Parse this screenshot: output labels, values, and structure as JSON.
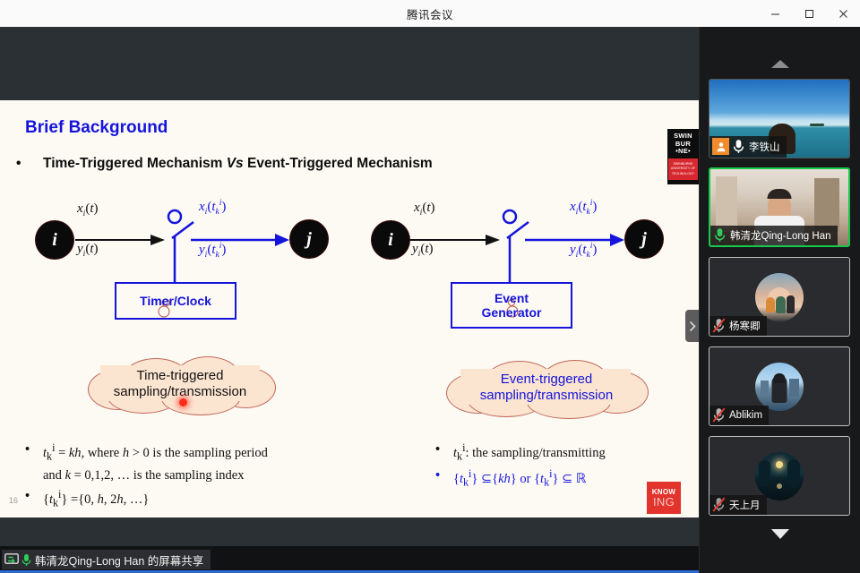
{
  "window": {
    "title": "腾讯会议",
    "controls": [
      {
        "name": "minimize",
        "glyph": "—"
      },
      {
        "name": "maximize",
        "glyph": "▢"
      },
      {
        "name": "close",
        "glyph": "✕"
      }
    ]
  },
  "slide": {
    "title": "Brief Background",
    "bullet_main_pre": "Time-Triggered Mechanism ",
    "bullet_main_em": "Vs",
    "bullet_main_post": " Event-Triggered Mechanism",
    "number": "16",
    "left_diagram": {
      "node_source": "i",
      "node_target": "j",
      "label_in_top_x": "x",
      "label_in_top_sub": "i",
      "label_in_top_arg": "(t)",
      "label_in_bot_y": "y",
      "label_in_bot_sub": "i",
      "label_in_bot_arg": "(t)",
      "label_out_top_x": "x",
      "label_out_top_sub": "i",
      "label_out_top_arg_t": "t",
      "label_out_top_arg_sub": "k",
      "label_out_top_arg_sup": "i",
      "label_out_bot_y": "y",
      "box_label": "Timer/Clock",
      "cloud_line1": "Time-triggered",
      "cloud_line2": "sampling/transmission"
    },
    "right_diagram": {
      "node_source": "i",
      "node_target": "j",
      "box_label_line1": "Event",
      "box_label_line2": "Generator",
      "cloud_line1": "Event-triggered",
      "cloud_line2": "sampling/transmission"
    },
    "left_notes": [
      {
        "segments": "t_k^i = kh, where h > 0 is the sampling period"
      },
      {
        "segments": "and k = 0,1,2, … is the sampling index"
      },
      {
        "segments": "{t_k^i} ={0, h, 2h, …}"
      }
    ],
    "right_notes": [
      {
        "segments": "t_k^i: the sampling/transmitting"
      },
      {
        "segments": "{t_k^i} ⊆{kh} or {t_k^i} ⊆ ℝ"
      }
    ],
    "swinburne_logo": {
      "line1": "SWIN",
      "line2": "BUR",
      "line3": "•NE•",
      "sub1": "SWINBURNE",
      "sub2": "UNIVERSITY OF",
      "sub3": "TECHNOLOGY"
    },
    "knowing_logo": {
      "line1": "KNOW",
      "line2": "ING"
    },
    "collapse_handle_icon": "chevron-right-icon"
  },
  "panel": {
    "scroll_up_icon": "triangle-up-icon",
    "scroll_down_icon": "triangle-down-icon",
    "participants": [
      {
        "name": "李铁山",
        "is_host": true,
        "muted": false,
        "speaking": false,
        "mic_state": "on",
        "video": "on",
        "border": "grey",
        "background_type": "beach"
      },
      {
        "name": "韩清龙Qing-Long Han",
        "is_host": false,
        "muted": false,
        "speaking": true,
        "mic_state": "active",
        "video": "on",
        "border": "green",
        "background_type": "room"
      },
      {
        "name": "杨寒卿",
        "is_host": false,
        "muted": true,
        "speaking": false,
        "mic_state": "muted",
        "video": "off",
        "border": "light",
        "background_type": "avatar-sunset"
      },
      {
        "name": "Ablikim",
        "is_host": false,
        "muted": true,
        "speaking": false,
        "mic_state": "muted",
        "video": "off",
        "border": "light",
        "background_type": "avatar-city"
      },
      {
        "name": "天上月",
        "is_host": false,
        "muted": true,
        "speaking": false,
        "mic_state": "muted",
        "video": "off",
        "border": "light",
        "background_type": "avatar-moon"
      }
    ]
  },
  "share_bar": {
    "screen_icon": "screen-share-icon",
    "mic_icon": "microphone-icon",
    "label": "韩清龙Qing-Long Han 的屏幕共享"
  },
  "colors": {
    "accent_blue": "#1414dc",
    "speaking_green": "#17c94a",
    "host_orange": "#f28b2b",
    "logo_red": "#e2332c",
    "slide_bg": "#fdfaf4",
    "letterbox": "#2b3034",
    "panel_bg": "#18191b",
    "taskbar_blue": "#2d6bd4"
  }
}
